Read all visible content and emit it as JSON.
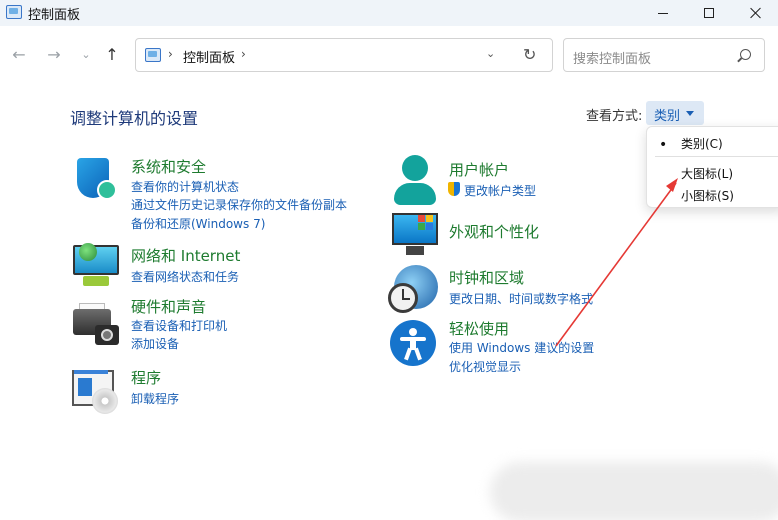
{
  "window": {
    "title": "控制面板"
  },
  "nav": {
    "back": "←",
    "forward": "→",
    "recent": "⌄",
    "up": "↑"
  },
  "address": {
    "separator": "›",
    "crumb": "控制面板",
    "dropdown": "⌄",
    "refresh": "↻"
  },
  "search": {
    "placeholder": "搜索控制面板"
  },
  "header": {
    "title": "调整计算机的设置",
    "view_by_label": "查看方式:",
    "view_by_value": "类别"
  },
  "view_menu": {
    "items": [
      {
        "label": "类别(C)",
        "selected": true
      },
      {
        "label": "大图标(L)",
        "selected": false
      },
      {
        "label": "小图标(S)",
        "selected": false
      }
    ],
    "bullet": "•"
  },
  "categories": {
    "system_security": {
      "title": "系统和安全",
      "links": [
        "查看你的计算机状态",
        "通过文件历史记录保存你的文件备份副本",
        "备份和还原(Windows 7)"
      ]
    },
    "user_accounts": {
      "title": "用户帐户",
      "links": [
        "更改帐户类型"
      ]
    },
    "network": {
      "title": "网络和 Internet",
      "links": [
        "查看网络状态和任务"
      ]
    },
    "appearance": {
      "title": "外观和个性化",
      "links": []
    },
    "hardware_sound": {
      "title": "硬件和声音",
      "links": [
        "查看设备和打印机",
        "添加设备"
      ]
    },
    "clock_region": {
      "title": "时钟和区域",
      "links": [
        "更改日期、时间或数字格式"
      ]
    },
    "ease_of_access": {
      "title": "轻松使用",
      "links": [
        "使用 Windows 建议的设置",
        "优化视觉显示"
      ]
    },
    "programs": {
      "title": "程序",
      "links": [
        "卸载程序"
      ]
    }
  },
  "annotation": {
    "arrow_color": "#e53935"
  },
  "colors": {
    "category_title": "#1e7b2f",
    "link": "#1a5fb4",
    "page_title": "#1e3a7a",
    "titlebar_bg": "#eff4f9"
  }
}
